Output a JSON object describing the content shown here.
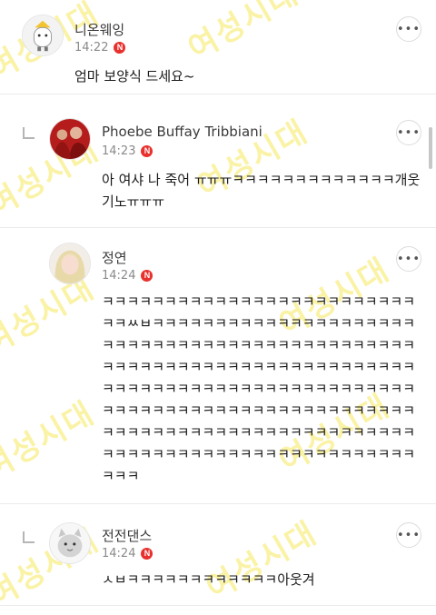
{
  "watermark": "여성시대",
  "more_glyph": "•••",
  "badge_letter": "N",
  "comments": [
    {
      "author": "니온웨잉",
      "time": "14:22",
      "text": "엄마 보양식 드세요~",
      "reply": false
    },
    {
      "author": "Phoebe Buffay Tribbiani",
      "time": "14:23",
      "text": "아 여샤 나 죽어 ㅠㅠㅠㅋㅋㅋㅋㅋㅋㅋㅋㅋㅋㅋㅋㅋ개웃기노ㅠㅠㅠ",
      "reply": true
    },
    {
      "author": "정연",
      "time": "14:24",
      "text": "ㅋㅋㅋㅋㅋㅋㅋㅋㅋㅋㅋㅋㅋㅋㅋㅋㅋㅋㅋㅋㅋㅋㅋㅋㅋㅋㅋㅆㅂㅋㅋㅋㅋㅋㅋㅋㅋㅋㅋㅋㅋㅋㅋㅋㅋㅋㅋㅋㅋㅋㅋㅋㅋㅋㅋㅋㅋㅋㅋㅋㅋㅋㅋㅋㅋㅋㅋㅋㅋㅋㅋㅋㅋㅋㅋㅋㅋㅋㅋㅋㅋㅋㅋㅋㅋㅋㅋㅋㅋㅋㅋㅋㅋㅋㅋㅋㅋㅋㅋㅋㅋㅋㅋㅋㅋㅋㅋㅋㅋㅋㅋㅋㅋㅋㅋㅋㅋㅋㅋㅋㅋㅋㅋㅋㅋㅋㅋㅋㅋㅋㅋㅋㅋㅋㅋㅋㅋㅋㅋㅋㅋㅋㅋㅋㅋㅋㅋㅋㅋㅋㅋㅋㅋㅋㅋㅋㅋㅋㅋㅋㅋㅋㅋㅋㅋㅋㅋㅋㅋㅋㅋㅋㅋㅋㅋㅋㅋㅋㅋㅋㅋㅋㅋㅋㅋㅋㅋㅋㅋㅋㅋㅋㅋㅋㅋㅋㅋㅋㅋㅋㅋㅋㅋ",
      "reply": true
    },
    {
      "author": "전전댄스",
      "time": "14:24",
      "text": "ㅅㅂㅋㅋㅋㅋㅋㅋㅋㅋㅋㅋㅋㅋ아웃겨",
      "reply": true
    }
  ],
  "colors": {
    "badge": "#e8302c",
    "watermark": "#f6e85a",
    "divider": "#ebebeb"
  }
}
